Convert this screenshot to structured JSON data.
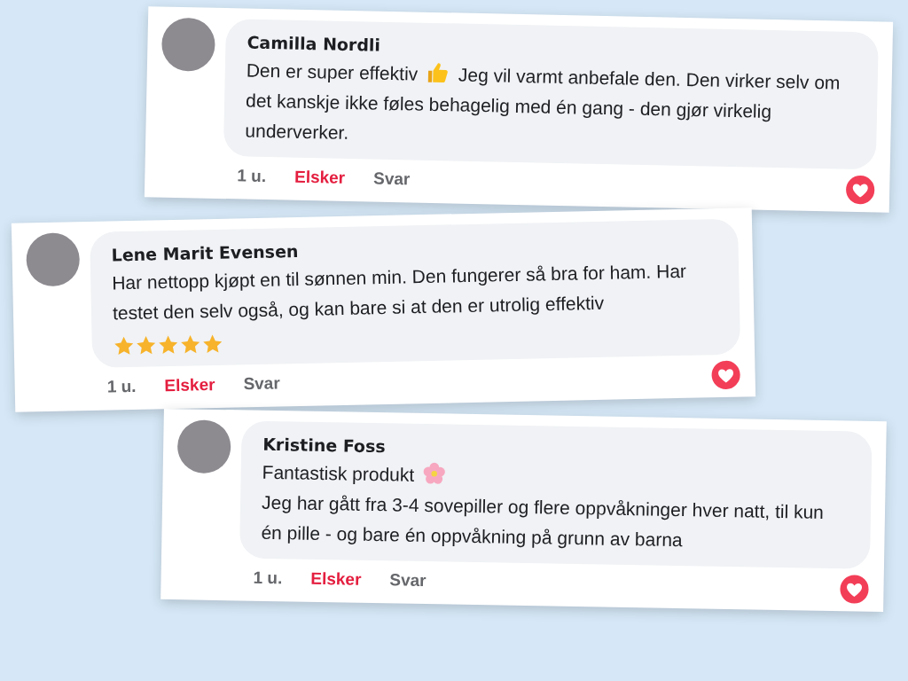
{
  "comments": [
    {
      "author": "Camilla Nordli",
      "paragraphs": [
        [
          {
            "kind": "text",
            "text": "Den er super effektiv"
          },
          {
            "kind": "thumbs-up"
          },
          {
            "kind": "text",
            "text": "Jeg vil varmt anbefale den. Den virker selv om det kanskje ikke føles behagelig med én gang - den gjør virkelig underverker."
          }
        ]
      ],
      "time": "1 u.",
      "reaction_label": "Elsker",
      "loved": true,
      "reply_label": "Svar"
    },
    {
      "author": "Lene Marit Evensen",
      "paragraphs": [
        [
          {
            "kind": "text",
            "text": "Har nettopp kjøpt en til sønnen min. Den fungerer så bra for ham. Har testet den selv også, og kan bare si at den er utrolig effektiv"
          }
        ]
      ],
      "stars": 5,
      "time": "1 u.",
      "reaction_label": "Elsker",
      "loved": true,
      "reply_label": "Svar"
    },
    {
      "author": "Kristine Foss",
      "paragraphs": [
        [
          {
            "kind": "text",
            "text": "Fantastisk produkt"
          },
          {
            "kind": "flower"
          }
        ],
        [
          {
            "kind": "text",
            "text": "Jeg har gått fra 3-4 sovepiller og flere oppvåkninger hver natt, til kun én pille - og bare én oppvåkning på grunn av barna"
          }
        ]
      ],
      "time": "1 u.",
      "reaction_label": "Elsker",
      "loved": true,
      "reply_label": "Svar"
    }
  ]
}
